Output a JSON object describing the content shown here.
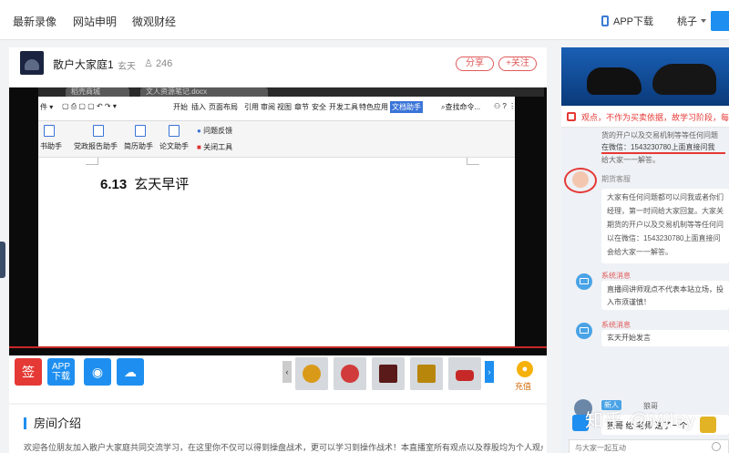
{
  "topbar": {
    "nav": [
      "最新录像",
      "网站申明",
      "微观财经"
    ],
    "app_download": "APP下载",
    "user_name": "桃子"
  },
  "room": {
    "title": "散户大家庭1",
    "host_tag": "玄天",
    "viewers": "246",
    "share_label": "分享",
    "follow_label": "+关注"
  },
  "video": {
    "browser_tabs": [
      "稻壳商城",
      "文人资源笔记.docx"
    ],
    "menu_items": [
      "开始",
      "插入",
      "页面布局",
      "引用",
      "审阅",
      "视图",
      "章节",
      "安全",
      "开发工具",
      "特色应用"
    ],
    "menu_highlight": "文档助手",
    "search_label": "查找命令...",
    "tools": [
      "书助手",
      "党政报告助手",
      "简历助手",
      "论文助手"
    ],
    "side_tools": [
      "问题反馈",
      "关闭工具"
    ],
    "doc_number": "6.13",
    "doc_title": "玄天早评"
  },
  "toolbar": {
    "sign_label": "签",
    "app_label": "APP\n下载",
    "weibo_label": "微博",
    "wechat_label": "微信",
    "charge_label": "充值"
  },
  "intro": {
    "heading": "房间介绍",
    "text": "欢迎各位朋友加入散户大家庭共同交流学习，在这里你不仅可以得到操盘战术，更可以学习到操作战术！本直播室所有观点以及荐股均为个人观点，"
  },
  "chat": {
    "ticker": "观点，不作为买卖依据，故学习阶段，每次",
    "msg1_lines": [
      "货的开户以及交易机制等等任何问题",
      "在微信：1543230780上面直接问我",
      "给大家一一解答。"
    ],
    "cs_name": "期货客服",
    "cs_lines": [
      "大家有任何问题都可以问我或者你们",
      "经理，第一时间给大家回复。大家关",
      "期货的开户以及交易机制等等任何问",
      "以在微信：1543230780上面直接问",
      "会给大家一一解答。"
    ],
    "sys1_name": "系统消息",
    "sys1_lines": [
      "直播间讲师观点不代表本站立场，投",
      "入市须谨慎！"
    ],
    "sys2_name": "系统消息",
    "sys2_line": "玄天开始发言",
    "guest_badge": "新人",
    "guest_name": "狼哥",
    "guest_msg": "狼哥 给 老师 送了一个",
    "watermark": "知乎 @Miley",
    "input_placeholder": "与大家一起互动"
  }
}
